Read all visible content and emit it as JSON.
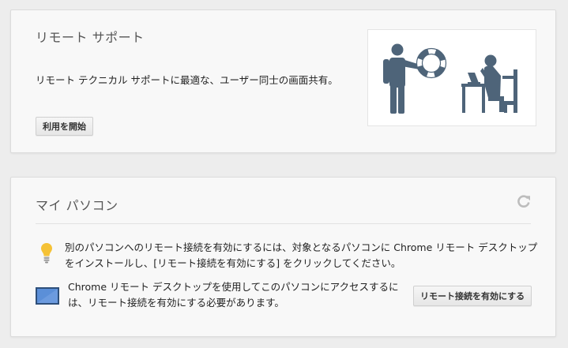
{
  "support": {
    "title": "リモート サポート",
    "description": "リモート テクニカル サポートに最適な、ユーザー同士の画面共有。",
    "start_button": "利用を開始"
  },
  "my_pc": {
    "title": "マイ パソコン",
    "info_text": "別のパソコンへのリモート接続を有効にするには、対象となるパソコンに Chrome リモート デスクトップをインストールし、[リモート接続を有効にする] をクリックしてください。",
    "access_text": "Chrome リモート デスクトップを使用してこのパソコンにアクセスするには、リモート接続を有効にする必要があります。",
    "enable_button": "リモート接続を有効にする"
  },
  "icons": {
    "refresh": "refresh-icon",
    "bulb": "lightbulb-icon",
    "monitor": "monitor-icon",
    "illustration": "remote-support-illustration"
  },
  "colors": {
    "figure": "#4e6479",
    "bulb": "#f5c236",
    "monitor_frame": "#2e4f7a",
    "monitor_screen": "#5b8fd8"
  }
}
